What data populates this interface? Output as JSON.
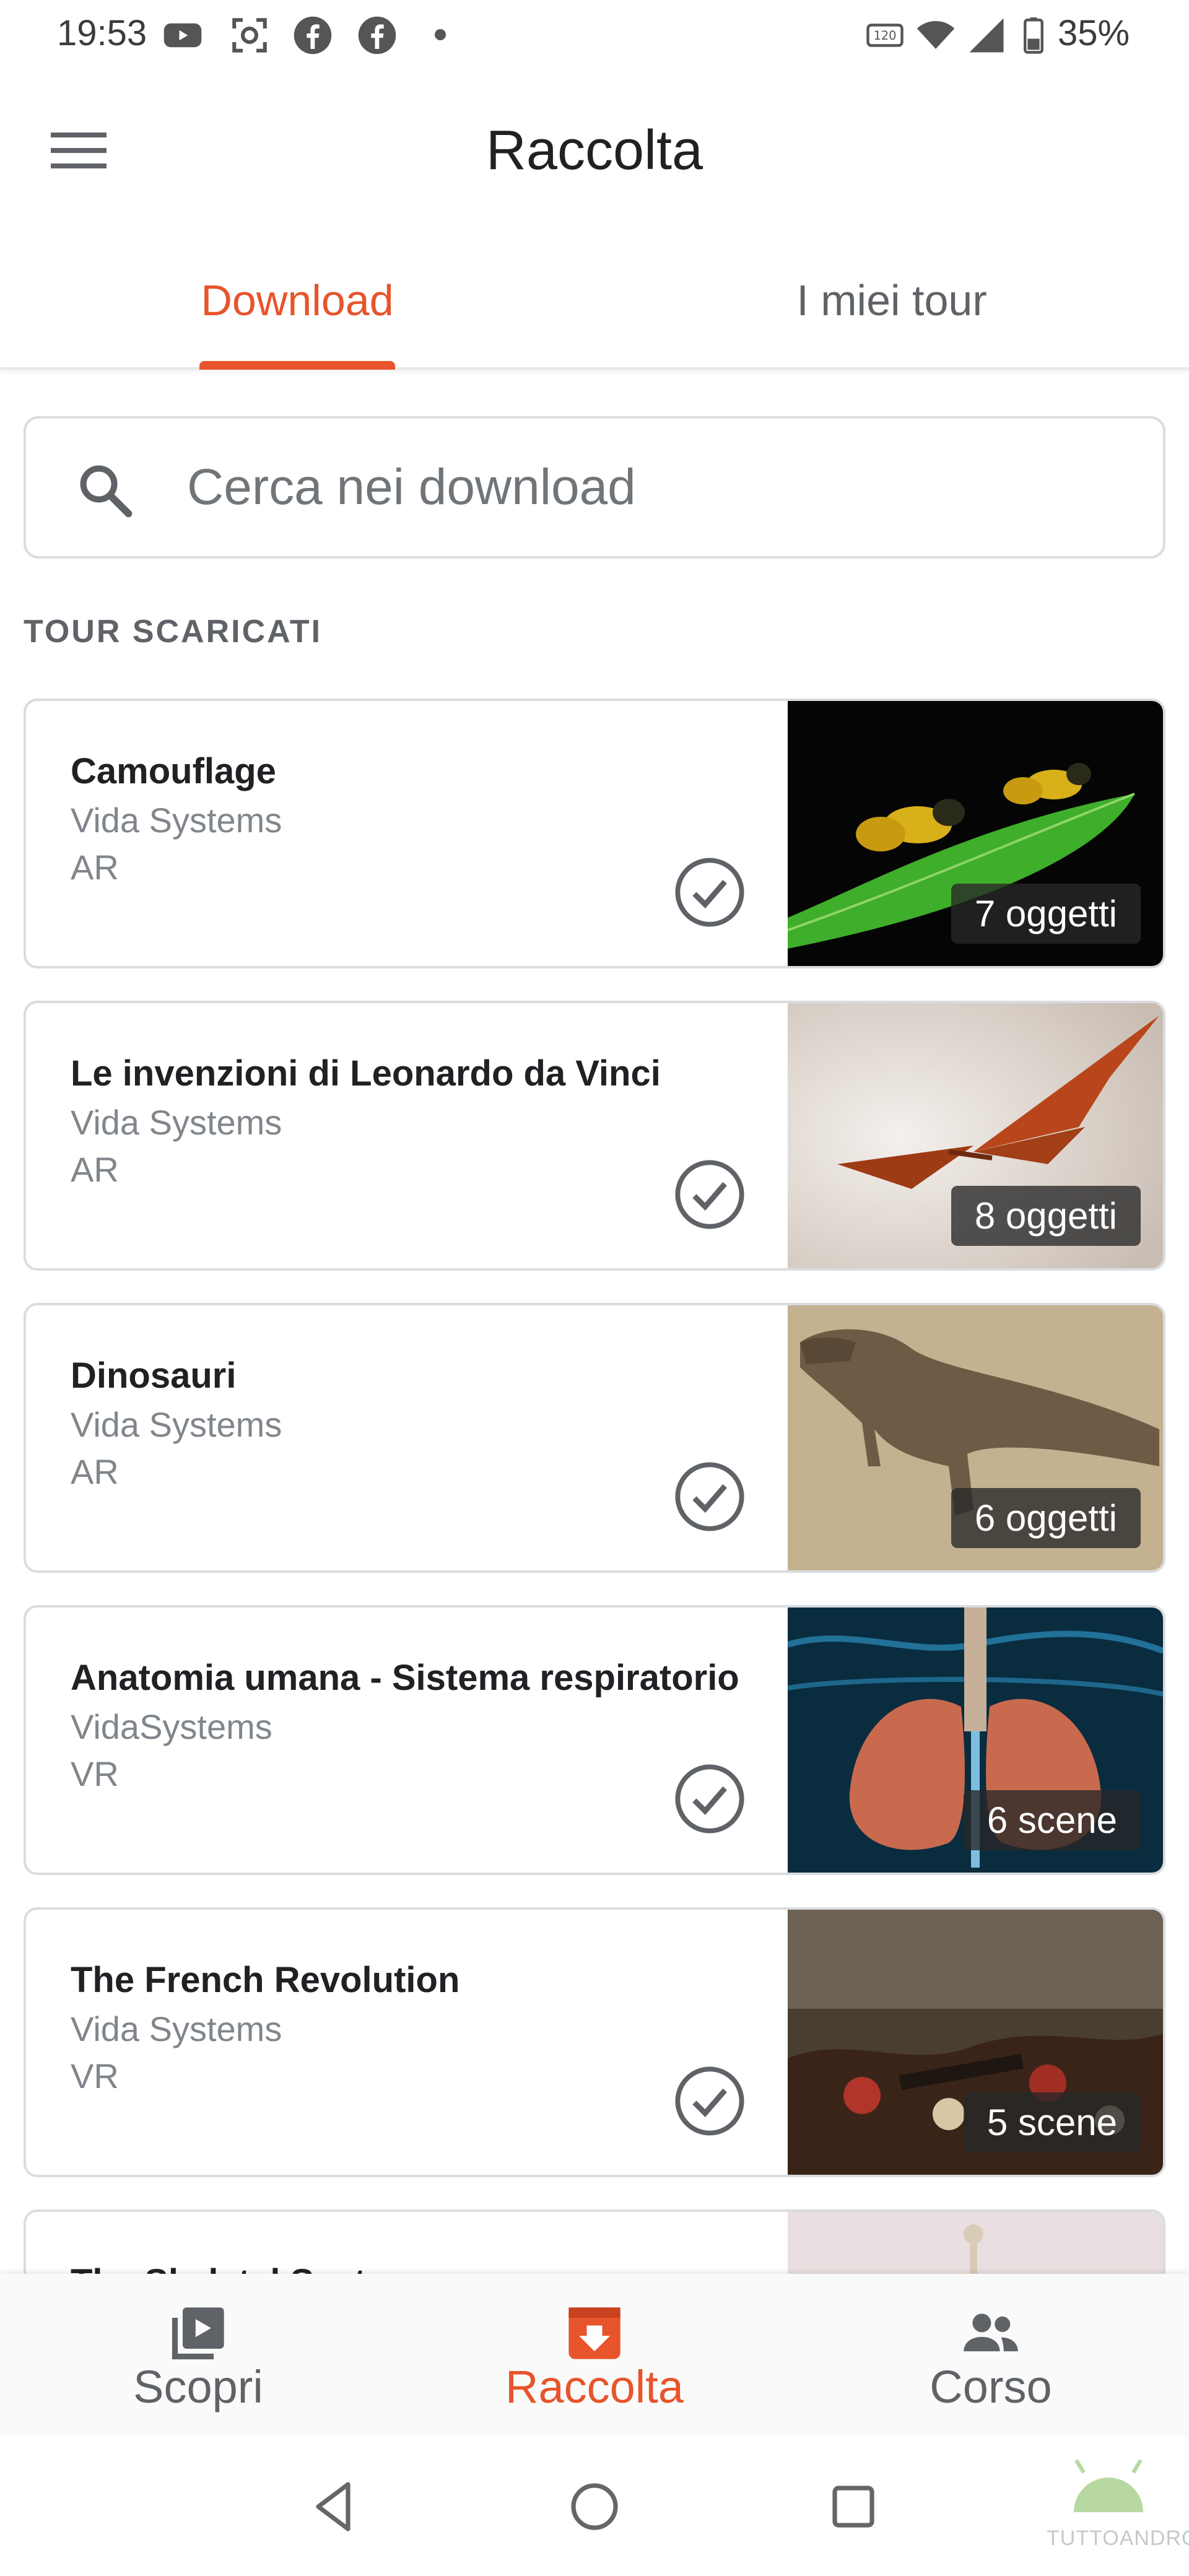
{
  "status_bar": {
    "time": "19:53",
    "battery": "35%",
    "icons": [
      "youtube-icon",
      "screenshot-icon",
      "facebook-icon",
      "facebook-icon",
      "notification-dot",
      "hd-voice-icon",
      "wifi-icon",
      "signal-icon",
      "battery-icon"
    ]
  },
  "app_bar": {
    "title": "Raccolta",
    "menu_icon": "hamburger-menu-icon"
  },
  "tabs": [
    {
      "label": "Download",
      "active": true
    },
    {
      "label": "I miei tour",
      "active": false
    }
  ],
  "search": {
    "placeholder": "Cerca nei download",
    "icon": "search-icon"
  },
  "section_label": "TOUR SCARICATI",
  "tours": [
    {
      "title": "Camouflage",
      "author": "Vida Systems",
      "type": "AR",
      "count": "7 oggetti"
    },
    {
      "title": "Le invenzioni di Leonardo da Vinci",
      "author": "Vida Systems",
      "type": "AR",
      "count": "8 oggetti"
    },
    {
      "title": "Dinosauri",
      "author": "Vida Systems",
      "type": "AR",
      "count": "6 oggetti"
    },
    {
      "title": "Anatomia umana - Sistema respiratorio",
      "author": "VidaSystems",
      "type": "VR",
      "count": "6 scene"
    },
    {
      "title": "The French Revolution",
      "author": "Vida Systems",
      "type": "VR",
      "count": "5 scene"
    },
    {
      "title": "The Skeletal System",
      "author": "",
      "type": "",
      "count": ""
    }
  ],
  "bottom_nav": [
    {
      "label": "Scopri",
      "icon": "video-library-icon",
      "active": false
    },
    {
      "label": "Raccolta",
      "icon": "download-inbox-icon",
      "active": true
    },
    {
      "label": "Corso",
      "icon": "people-icon",
      "active": false
    }
  ],
  "colors": {
    "accent": "#e8542b",
    "text_primary": "#202124",
    "text_secondary": "#80868b",
    "border": "#dadce0"
  },
  "watermark": "TUTTOANDROID"
}
